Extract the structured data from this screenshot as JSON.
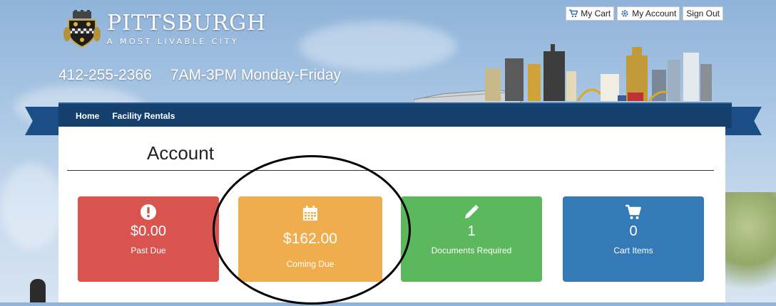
{
  "header": {
    "logo_title": "PITTSBURGH",
    "logo_subtitle": "A MOST LIVABLE CITY",
    "phone": "412-255-2366",
    "hours": "7AM-3PM Monday-Friday"
  },
  "top_links": [
    {
      "label": "My Cart",
      "icon": "cart-icon"
    },
    {
      "label": "My Account",
      "icon": "gear-icon"
    },
    {
      "label": "Sign Out",
      "icon": ""
    }
  ],
  "nav": {
    "items": [
      {
        "label": "Home"
      },
      {
        "label": "Facility Rentals"
      }
    ]
  },
  "page": {
    "title": "Account"
  },
  "tiles": [
    {
      "amount": "$0.00",
      "label": "Past Due",
      "icon": "exclamation-icon",
      "color": "#d9534f"
    },
    {
      "amount": "$162.00",
      "label": "Coming Due",
      "icon": "calendar-icon",
      "color": "#f0ad4e"
    },
    {
      "amount": "1",
      "label": "Documents Required",
      "icon": "pencil-icon",
      "color": "#5cb85c"
    },
    {
      "amount": "0",
      "label": "Cart Items",
      "icon": "cart-icon",
      "color": "#337ab7"
    }
  ],
  "colors": {
    "nav_bg": "#15406e",
    "ribbon": "#1b4e86"
  }
}
